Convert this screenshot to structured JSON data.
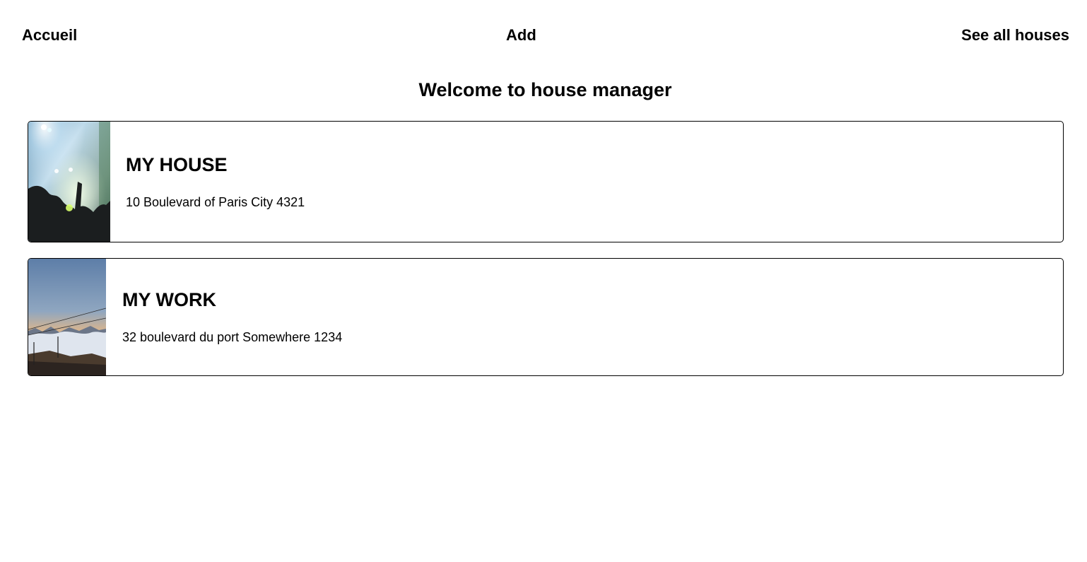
{
  "nav": {
    "home": "Accueil",
    "add": "Add",
    "all_houses": "See all houses"
  },
  "page": {
    "title": "Welcome to house manager"
  },
  "houses": [
    {
      "name": "MY HOUSE",
      "address": "10 Boulevard of Paris City 4321",
      "image": "concert-crowd-photo"
    },
    {
      "name": "MY WORK",
      "address": "32 boulevard du port Somewhere 1234",
      "image": "mountain-sunset-photo"
    }
  ]
}
